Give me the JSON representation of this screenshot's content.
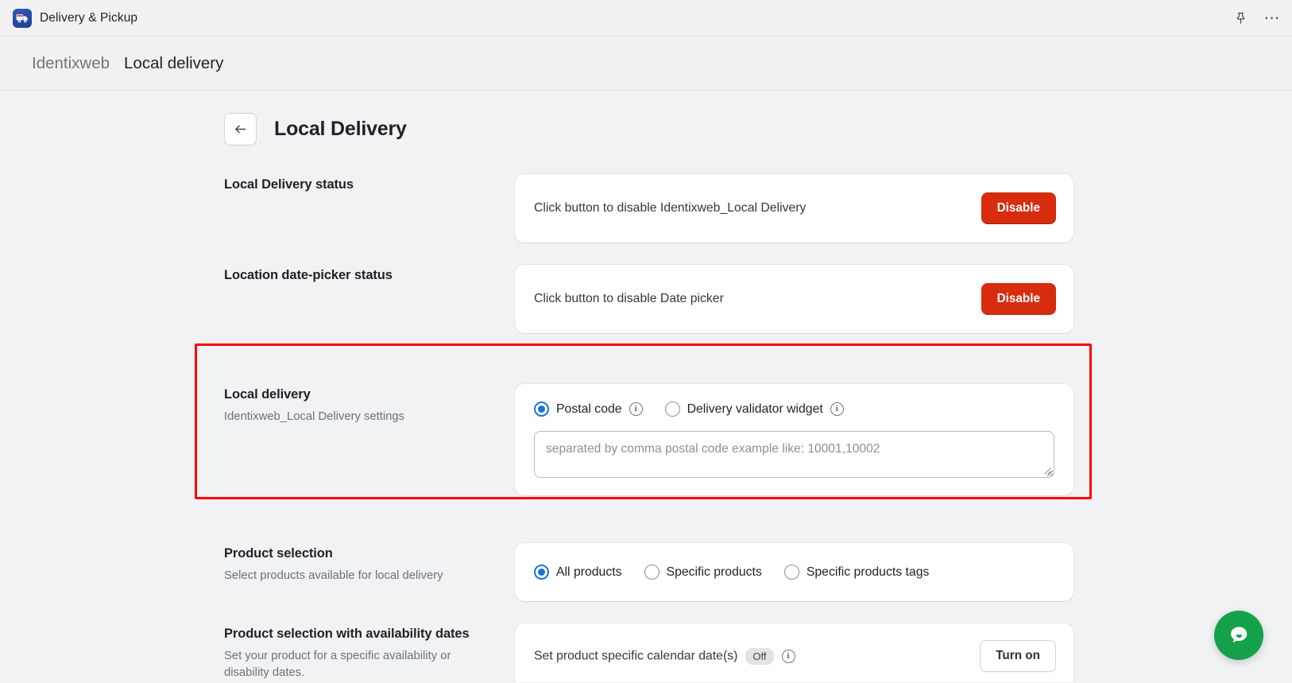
{
  "appbar": {
    "title": "Delivery & Pickup",
    "app_icon": "delivery-truck-icon",
    "pin_icon": "pin-icon",
    "more_icon": "more-options-icon"
  },
  "breadcrumb": {
    "parent": "Identixweb",
    "current": "Local delivery"
  },
  "page": {
    "back_label": "←",
    "title": "Local Delivery"
  },
  "sections": {
    "local_delivery_status": {
      "label": "Local Delivery status",
      "card_text": "Click button to disable Identixweb_Local Delivery",
      "button": "Disable"
    },
    "date_picker_status": {
      "label": "Location date-picker status",
      "card_text": "Click button to disable Date picker",
      "button": "Disable"
    },
    "local_delivery": {
      "label": "Local delivery",
      "sublabel": "Identixweb_Local Delivery settings",
      "options": [
        {
          "label": "Postal code",
          "checked": true,
          "info": "info-icon"
        },
        {
          "label": "Delivery validator widget",
          "checked": false,
          "info": "info-icon"
        }
      ],
      "textarea_value": "",
      "textarea_placeholder": "separated by comma postal code example like: 10001,10002"
    },
    "product_selection": {
      "label": "Product selection",
      "sublabel": "Select products available for local delivery",
      "options": [
        {
          "label": "All products",
          "checked": true
        },
        {
          "label": "Specific products",
          "checked": false
        },
        {
          "label": "Specific products tags",
          "checked": false
        }
      ]
    },
    "availability_dates": {
      "label": "Product selection with availability dates",
      "sublabel": "Set your product for a specific availability or disability dates.",
      "card_text": "Set product specific calendar date(s)",
      "status_badge": "Off",
      "info": "info-icon",
      "button": "Turn on"
    }
  },
  "chat_widget": {
    "icon": "chat-bubble-icon"
  },
  "colors": {
    "danger": "#d72c0d",
    "accent": "#1a73d9",
    "highlight": "#ff0000",
    "chat_green": "#14a14a",
    "page_bg": "#f1f2f4"
  }
}
